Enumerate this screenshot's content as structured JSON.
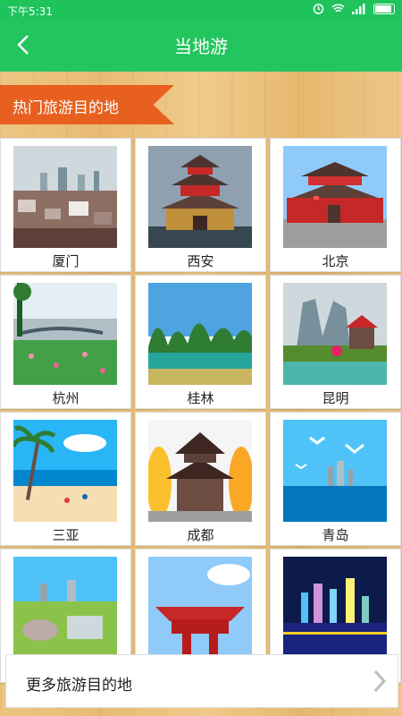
{
  "status": {
    "time": "下午5:31"
  },
  "header": {
    "title": "当地游"
  },
  "section": {
    "title": "热门旅游目的地"
  },
  "destinations": [
    {
      "name": "厦门"
    },
    {
      "name": "西安"
    },
    {
      "name": "北京"
    },
    {
      "name": "杭州"
    },
    {
      "name": "桂林"
    },
    {
      "name": "昆明"
    },
    {
      "name": "三亚"
    },
    {
      "name": "成都"
    },
    {
      "name": "青岛"
    },
    {
      "name": ""
    },
    {
      "name": ""
    },
    {
      "name": ""
    }
  ],
  "more": {
    "label": "更多旅游目的地"
  },
  "colors": {
    "accent": "#22c55e",
    "ribbon": "#e8601f"
  }
}
